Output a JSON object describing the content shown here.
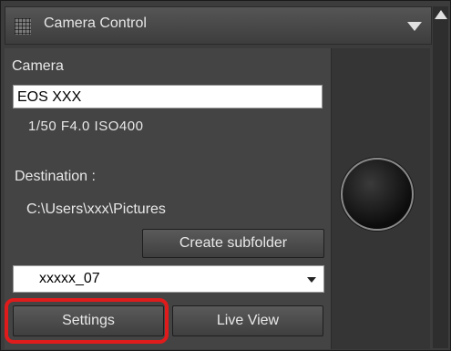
{
  "header": {
    "title": "Camera Control"
  },
  "camera": {
    "label": "Camera",
    "name": "EOS XXX",
    "settings": "1/50  F4.0  ISO400"
  },
  "destination": {
    "label": "Destination :",
    "path": "C:\\Users\\xxx\\Pictures",
    "create_subfolder_label": "Create subfolder",
    "folder_value": "xxxxx_07"
  },
  "buttons": {
    "settings_label": "Settings",
    "live_view_label": "Live View"
  },
  "icons": {
    "grip": "grip-icon",
    "menu": "chevron-down-icon",
    "scroll_up": "scroll-up-icon",
    "select": "chevron-down-icon",
    "shutter": "shutter-button"
  },
  "colors": {
    "highlight": "#e01b1b",
    "panel": "#444444"
  }
}
